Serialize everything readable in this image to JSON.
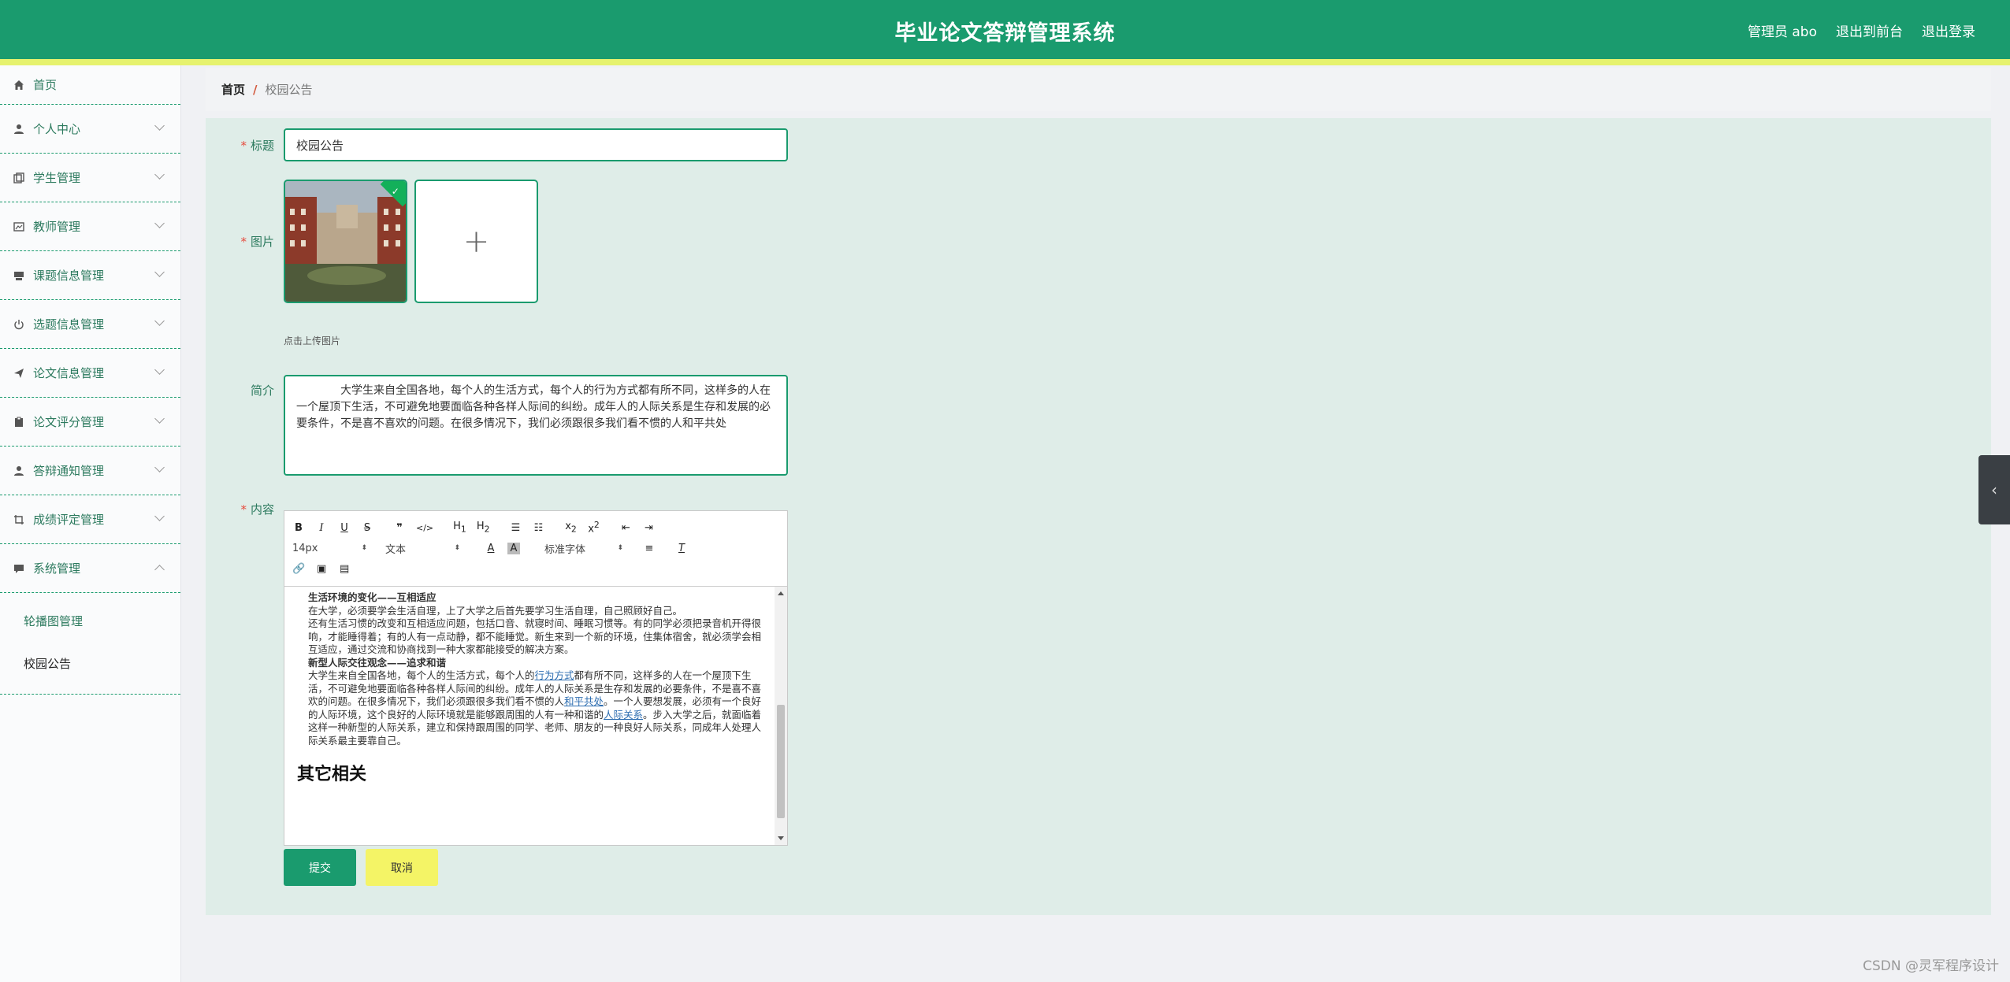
{
  "header": {
    "title": "毕业论文答辩管理系统",
    "user": "管理员 abo",
    "back_to_front": "退出到前台",
    "logout": "退出登录"
  },
  "sidebar": {
    "items": [
      {
        "label": "首页",
        "icon": "home-icon"
      },
      {
        "label": "个人中心",
        "icon": "user-icon"
      },
      {
        "label": "学生管理",
        "icon": "copy-icon"
      },
      {
        "label": "教师管理",
        "icon": "image-icon"
      },
      {
        "label": "课题信息管理",
        "icon": "folder-icon"
      },
      {
        "label": "选题信息管理",
        "icon": "power-icon"
      },
      {
        "label": "论文信息管理",
        "icon": "send-icon"
      },
      {
        "label": "论文评分管理",
        "icon": "clipboard-icon"
      },
      {
        "label": "答辩通知管理",
        "icon": "user-icon"
      },
      {
        "label": "成绩评定管理",
        "icon": "crop-icon"
      },
      {
        "label": "系统管理",
        "icon": "message-icon"
      }
    ],
    "sub_items": [
      "轮播图管理",
      "校园公告"
    ]
  },
  "breadcrumb": {
    "home": "首页",
    "current": "校园公告"
  },
  "form": {
    "title_label": "标题",
    "title_value": "校园公告",
    "image_label": "图片",
    "upload_tip": "点击上传图片",
    "intro_label": "简介",
    "intro_value": "大学生来自全国各地，每个人的生活方式，每个人的行为方式都有所不同，这样多的人在一个屋顶下生活，不可避免地要面临各种各样人际间的纠纷。成年人的人际关系是生存和发展的必要条件，不是喜不喜欢的问题。在很多情况下，我们必须跟很多我们看不惯的人和平共处",
    "content_label": "内容",
    "submit": "提交",
    "cancel": "取消"
  },
  "editor": {
    "font_size": "14px",
    "block_type": "文本",
    "font_family": "标准字体",
    "content": {
      "h1": "生活环境的变化——互相适应",
      "p1": "在大学，必须要学会生活自理，上了大学之后首先要学习生活自理，自己照顾好自己。",
      "p2": "还有生活习惯的改变和互相适应问题，包括口音、就寝时间、睡眠习惯等。有的同学必须把录音机开得很响，才能睡得着；有的人有一点动静，都不能睡觉。新生来到一个新的环境，住集体宿舍，就必须学会相互适应，通过交流和协商找到一种大家都能接受的解决方案。",
      "h2": "新型人际交往观念——追求和谐",
      "p3a": "大学生来自全国各地，每个人的生活方式，每个人的",
      "link1": "行为方式",
      "p3b": "都有所不同，这样多的人在一个屋顶下生活，不可避免地要面临各种各样人际间的纠纷。成年人的人际关系是生存和发展的必要条件，不是喜不喜欢的问题。在很多情况下，我们必须跟很多我们看不惯的人",
      "link2": "和平共处",
      "p3c": "。一个人要想发展，必须有一个良好的人际环境，这个良好的人际环境就是能够跟周围的人有一种和谐的",
      "link3": "人际关系",
      "p3d": "。步入大学之后，就面临着这样一种新型的人际关系，建立和保持跟周围的同学、老师、朋友的一种良好人际关系，同成年人处理人际关系最主要靠自己。",
      "h3": "其它相关"
    }
  },
  "watermark": "CSDN @灵军程序设计",
  "colors": {
    "primary": "#1a9b6e",
    "stripe": "#e6f26e",
    "cancel": "#f4f466",
    "panel": "#dfede8"
  }
}
